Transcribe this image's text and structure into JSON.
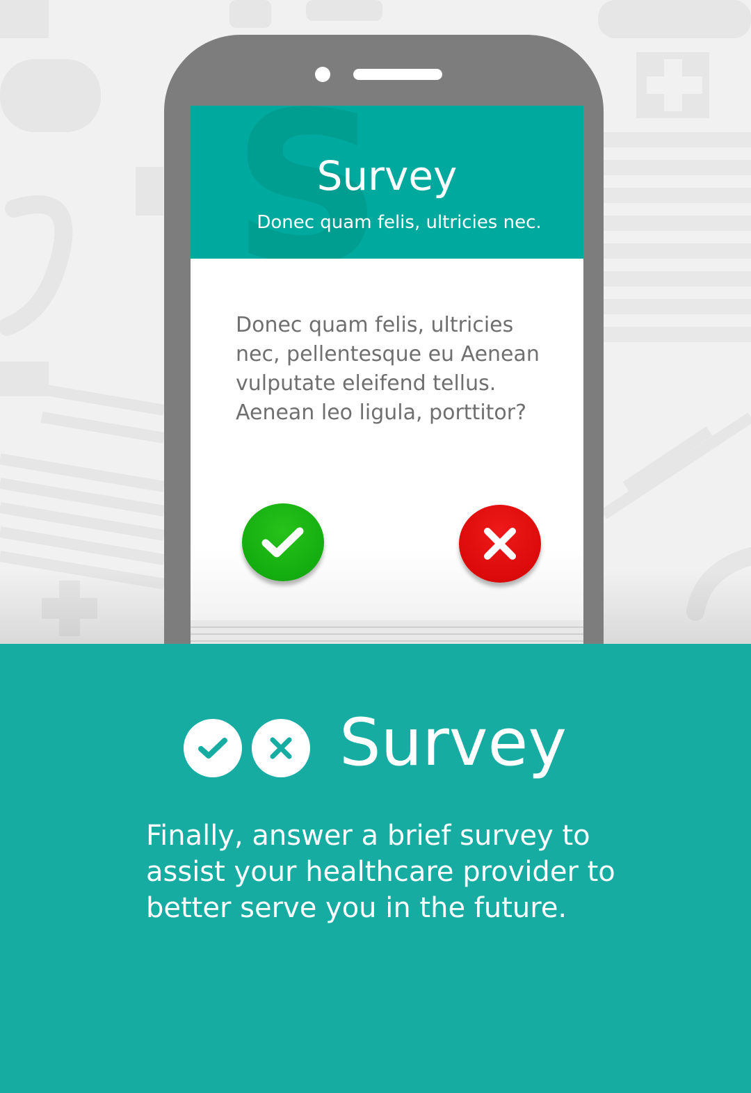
{
  "colors": {
    "teal_header": "#00a99d",
    "teal_footer": "#17aca2",
    "phone_body": "#7d7d7d",
    "yes_green": "#14ad10",
    "no_red": "#dc0a0a",
    "question_text": "#6f6f6f"
  },
  "phone": {
    "header": {
      "title": "Survey",
      "subtitle": "Donec quam felis, ultricies nec."
    },
    "question": "Donec quam felis, ultricies nec, pellentesque eu  Aenean vulputate eleifend tellus. Aenean leo ligula, porttitor?",
    "buttons": {
      "yes_icon": "check-icon",
      "no_icon": "close-icon"
    }
  },
  "footer": {
    "icons": [
      "check-circle-icon",
      "close-circle-icon"
    ],
    "title": "Survey",
    "description": "Finally, answer a brief survey to assist your healthcare provider to better serve you in the future."
  }
}
